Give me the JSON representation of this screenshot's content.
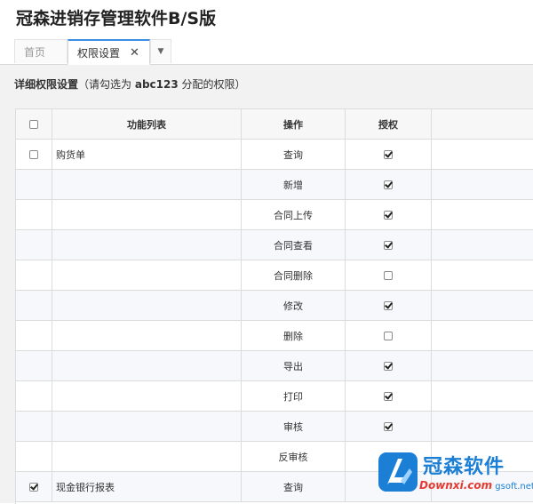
{
  "app": {
    "title": "冠森进销存管理软件B/S版"
  },
  "tabs": {
    "home": "首页",
    "permissions": "权限设置",
    "close_glyph": "✕",
    "menu_glyph": "▼"
  },
  "page": {
    "section_label": "详细权限设置",
    "hint_open": "（请勾选为",
    "user": "abc123",
    "hint_close": "分配的权限）"
  },
  "table": {
    "columns": [
      "",
      "功能列表",
      "操作",
      "授权"
    ],
    "header_checked": false,
    "rows": [
      {
        "row_checked": false,
        "function": "购货单",
        "operation": "查询",
        "authorized": true
      },
      {
        "row_checked": null,
        "function": "",
        "operation": "新增",
        "authorized": true
      },
      {
        "row_checked": null,
        "function": "",
        "operation": "合同上传",
        "authorized": true
      },
      {
        "row_checked": null,
        "function": "",
        "operation": "合同查看",
        "authorized": true
      },
      {
        "row_checked": null,
        "function": "",
        "operation": "合同删除",
        "authorized": false
      },
      {
        "row_checked": null,
        "function": "",
        "operation": "修改",
        "authorized": true
      },
      {
        "row_checked": null,
        "function": "",
        "operation": "删除",
        "authorized": false
      },
      {
        "row_checked": null,
        "function": "",
        "operation": "导出",
        "authorized": true
      },
      {
        "row_checked": null,
        "function": "",
        "operation": "打印",
        "authorized": true
      },
      {
        "row_checked": null,
        "function": "",
        "operation": "审核",
        "authorized": true
      },
      {
        "row_checked": null,
        "function": "",
        "operation": "反审核",
        "authorized": true
      },
      {
        "row_checked": true,
        "function": "现金银行报表",
        "operation": "查询",
        "authorized": true
      }
    ]
  },
  "watermark": {
    "brand": "冠森软件",
    "url_prefix": "Downxi.com",
    "url_main": "gsoft.net",
    "accent_color": "#1b7fd6"
  }
}
